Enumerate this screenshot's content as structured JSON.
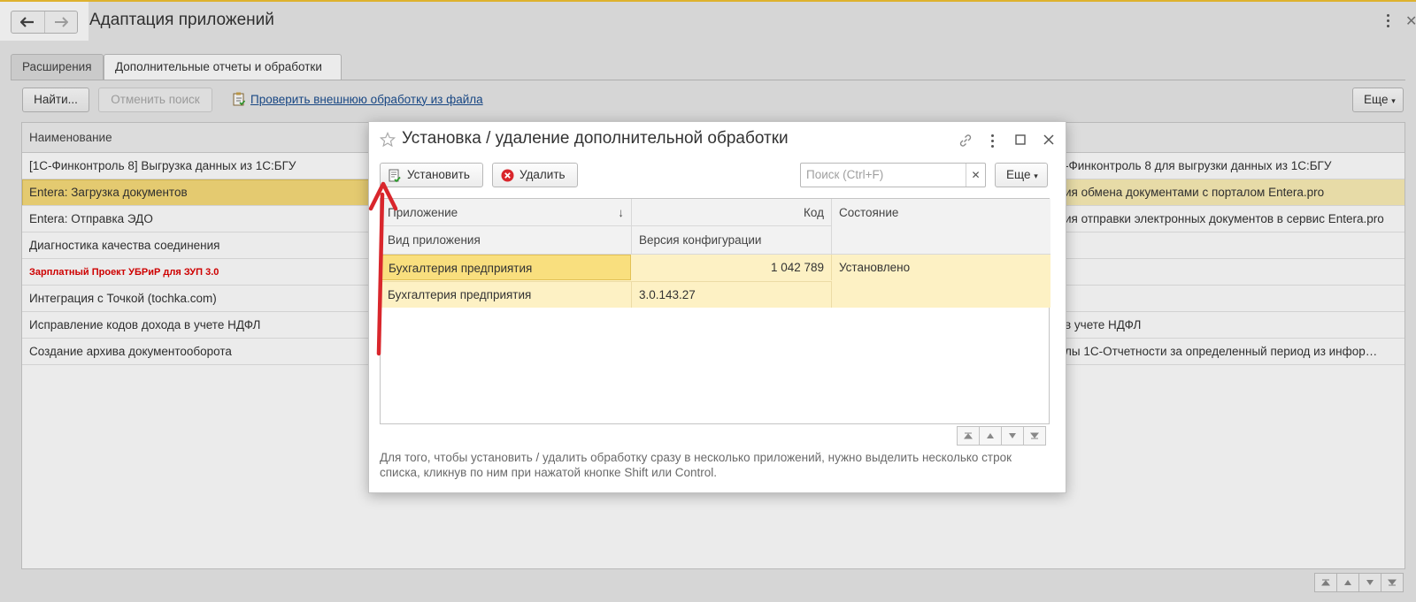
{
  "window": {
    "title": "Адаптация приложений",
    "accent": "#f1c232"
  },
  "tabs": [
    {
      "label": "Расширения"
    },
    {
      "label": "Дополнительные отчеты и обработки"
    }
  ],
  "toolbar": {
    "find_label": "Найти...",
    "cancel_search_label": "Отменить поиск",
    "check_link_label": "Проверить внешнюю обработку из файла",
    "more_label": "Еще"
  },
  "grid": {
    "header": "Наименование",
    "rows": [
      {
        "name": "[1С-Финконтроль 8] Выгрузка данных из 1С:БГУ",
        "desc": "-Финконтроль 8 для выгрузки данных из 1С:БГУ"
      },
      {
        "name": "Entera: Загрузка документов",
        "desc": "ия обмена документами с порталом Entera.pro"
      },
      {
        "name": "Entera: Отправка ЭДО",
        "desc": "ия отправки электронных документов в сервис Entera.pro"
      },
      {
        "name": "Диагностика качества соединения",
        "desc": ""
      },
      {
        "name": "Зарплатный Проект УБРиР для ЗУП 3.0",
        "desc": ""
      },
      {
        "name": "Интеграция с Точкой (tochka.com)",
        "desc": ""
      },
      {
        "name": "Исправление кодов дохода в учете НДФЛ",
        "desc": "в учете НДФЛ"
      },
      {
        "name": "Создание архива документооборота",
        "desc": "лы 1С-Отчетности за определенный период из инфор…"
      }
    ]
  },
  "dialog": {
    "title": "Установка / удаление дополнительной обработки",
    "install_label": "Установить",
    "delete_label": "Удалить",
    "search_placeholder": "Поиск (Ctrl+F)",
    "more_label": "Еще",
    "columns": {
      "app": "Приложение",
      "code": "Код",
      "state": "Состояние",
      "app_kind": "Вид приложения",
      "config_version": "Версия конфигурации"
    },
    "row": {
      "app": "Бухгалтерия предприятия",
      "code": "1 042 789",
      "state": "Установлено",
      "app_kind": "Бухгалтерия предприятия",
      "config_version": "3.0.143.27"
    },
    "hint": "Для того, чтобы установить / удалить обработку сразу в несколько приложений, нужно выделить несколько строк списка, кликнув по ним при нажатой кнопке Shift или Control."
  }
}
